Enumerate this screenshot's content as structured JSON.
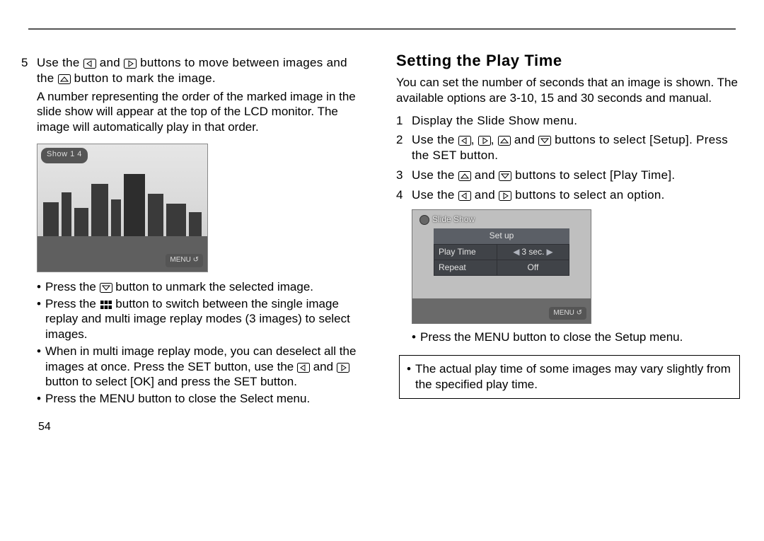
{
  "pageNumber": "54",
  "left": {
    "step5": {
      "num": "5",
      "text_a": "Use the ",
      "text_b": " and ",
      "text_c": " buttons to move between images and the ",
      "text_d": " button to mark the image."
    },
    "orderNote": "A number representing the order of the marked image in the slide show will appear at the top of the LCD monitor. The image will automatically play in that order.",
    "shot1": {
      "topbar": "Show 1   4",
      "menu": "MENU ↺"
    },
    "bullets": {
      "b1_a": "Press the ",
      "b1_b": " button to unmark the selected image.",
      "b2_a": "Press the ",
      "b2_b": " button to switch between the single image replay and multi image replay modes (3 images) to select images.",
      "b3_a": "When in multi image replay mode, you can deselect all the images at once. Press the SET button, use the ",
      "b3_b": " and ",
      "b3_c": " button to select [OK] and press the SET button.",
      "b4": "Press the MENU button to close the Select menu."
    }
  },
  "right": {
    "heading": "Setting the Play Time",
    "intro": "You can set the number of seconds that an image is shown. The available options are 3-10, 15 and 30 seconds and manual.",
    "step1": {
      "num": "1",
      "text": "Display the Slide Show menu."
    },
    "step2": {
      "num": "2",
      "a": "Use the ",
      "b": ", ",
      "c": ", ",
      "d": " and ",
      "e": " buttons to select [Setup]. Press the SET button."
    },
    "step3": {
      "num": "3",
      "a": "Use the ",
      "b": " and ",
      "c": " buttons to select [Play Time]."
    },
    "step4": {
      "num": "4",
      "a": "Use the ",
      "b": " and ",
      "c": " buttons to select an option."
    },
    "shot2": {
      "title": "Slide Show",
      "setup": "Set up",
      "row1k": "Play Time",
      "row1v": "3 sec.",
      "row2k": "Repeat",
      "row2v": "Off",
      "menu": "MENU ↺"
    },
    "bullet_close": "Press the MENU button to close the Setup menu.",
    "note": "The actual play time of some images may vary slightly from the specified play time."
  }
}
